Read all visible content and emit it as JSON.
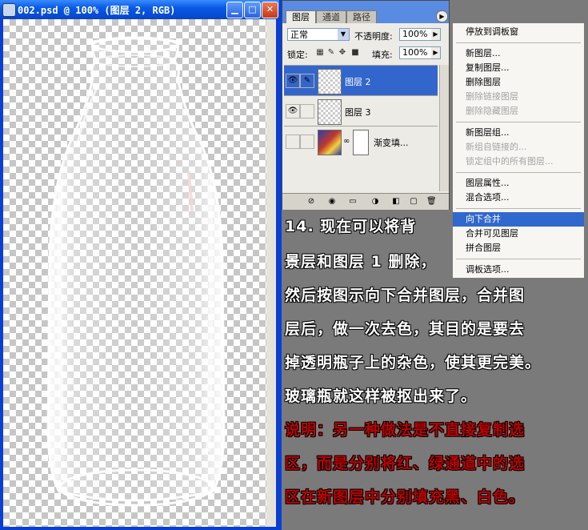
{
  "document": {
    "title": "002.psd @ 100% (图层 2, RGB)"
  },
  "layers_panel": {
    "tabs": [
      "图层",
      "通道",
      "路径"
    ],
    "blend_mode": "正常",
    "opacity_label": "不透明度:",
    "opacity_value": "100%",
    "lock_label": "锁定:",
    "fill_label": "填充:",
    "fill_value": "100%",
    "layers": [
      {
        "name": "图层 2",
        "selected": true
      },
      {
        "name": "图层 3",
        "selected": false
      },
      {
        "name": "渐变填...",
        "selected": false
      }
    ]
  },
  "context_menu": {
    "items": [
      {
        "label": "停放到调板窗",
        "disabled": false
      },
      {
        "label": "新图层...",
        "disabled": false
      },
      {
        "label": "复制图层...",
        "disabled": false
      },
      {
        "label": "删除图层",
        "disabled": false
      },
      {
        "label": "删除链接图层",
        "disabled": true
      },
      {
        "label": "删除隐藏图层",
        "disabled": true
      },
      {
        "label": "新图层组...",
        "disabled": false
      },
      {
        "label": "新组自链接的...",
        "disabled": true
      },
      {
        "label": "锁定组中的所有图层...",
        "disabled": true
      },
      {
        "label": "图层属性...",
        "disabled": false
      },
      {
        "label": "混合选项...",
        "disabled": false
      },
      {
        "label": "向下合并",
        "disabled": false,
        "highlighted": true
      },
      {
        "label": "合并可见图层",
        "disabled": false
      },
      {
        "label": "拼合图层",
        "disabled": false
      },
      {
        "label": "调板选项...",
        "disabled": false
      }
    ]
  },
  "tutorial": {
    "lines": [
      {
        "text": "14. 现在可以将背",
        "color": "white"
      },
      {
        "text": "景层和图层 1 删除，",
        "color": "white"
      },
      {
        "text": "然后按图示向下合并图层，合并图",
        "color": "white"
      },
      {
        "text": "层后，做一次去色，其目的是要去",
        "color": "white"
      },
      {
        "text": "掉透明瓶子上的杂色，使其更完美。",
        "color": "white"
      },
      {
        "text": "玻璃瓶就这样被抠出来了。",
        "color": "white"
      },
      {
        "text": "说明：另一种做法是不直接复制选",
        "color": "red"
      },
      {
        "text": "区，而是分别将红、绿通道中的选",
        "color": "red"
      },
      {
        "text": "区在新图层中分别填充黑、白色。",
        "color": "red"
      }
    ]
  },
  "colors": {
    "selection": "#3366cc",
    "menu_highlight": "#3168cd",
    "note_red": "#c00000"
  }
}
